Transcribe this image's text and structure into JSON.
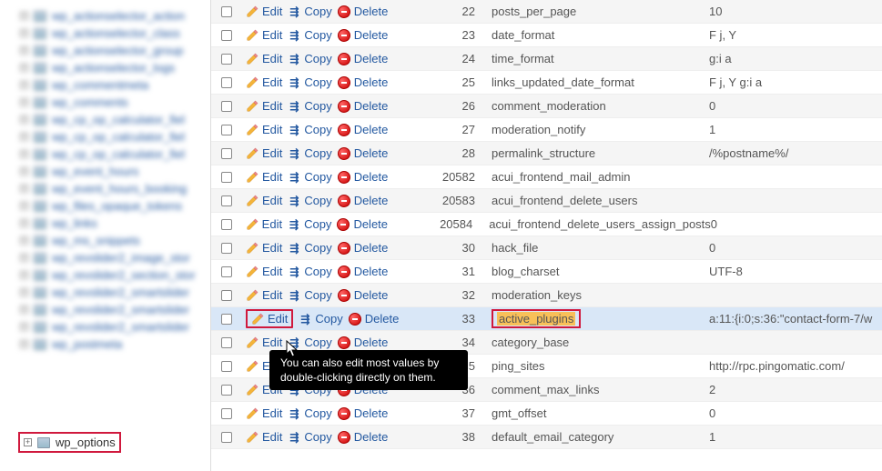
{
  "sidebar": {
    "blurred_items": [
      "wp_actionselector_action",
      "wp_actionselector_class",
      "wp_actionselector_group",
      "wp_actionselector_logs",
      "wp_commentmeta",
      "wp_comments",
      "wp_cp_op_calculator_fiel",
      "wp_cp_op_calculator_fiel",
      "wp_cp_op_calculator_fiel",
      "wp_event_hours",
      "wp_event_hours_booking",
      "wp_files_opaque_tokens",
      "wp_links",
      "wp_ms_snippets",
      "wp_revslider2_image_stor",
      "wp_revslider2_section_stor",
      "wp_revslider2_smartslider",
      "wp_revslider2_smartslider",
      "wp_revslider2_smartslider"
    ],
    "wp_options": "wp_options",
    "postmeta": "wp_postmeta"
  },
  "actions": {
    "edit": "Edit",
    "copy": "Copy",
    "delete": "Delete"
  },
  "tooltip": "You can also edit most values by double-clicking directly on them.",
  "rows": [
    {
      "id": "22",
      "name": "posts_per_page",
      "value": "10",
      "alt": true
    },
    {
      "id": "23",
      "name": "date_format",
      "value": "F j, Y"
    },
    {
      "id": "24",
      "name": "time_format",
      "value": "g:i a",
      "alt": true
    },
    {
      "id": "25",
      "name": "links_updated_date_format",
      "value": "F j, Y g:i a"
    },
    {
      "id": "26",
      "name": "comment_moderation",
      "value": "0",
      "alt": true
    },
    {
      "id": "27",
      "name": "moderation_notify",
      "value": "1"
    },
    {
      "id": "28",
      "name": "permalink_structure",
      "value": "/%postname%/",
      "alt": true
    },
    {
      "id": "20582",
      "name": "acui_frontend_mail_admin",
      "value": ""
    },
    {
      "id": "20583",
      "name": "acui_frontend_delete_users",
      "value": "",
      "alt": true
    },
    {
      "id": "20584",
      "name": "acui_frontend_delete_users_assign_posts",
      "value": "0"
    },
    {
      "id": "30",
      "name": "hack_file",
      "value": "0",
      "alt": true
    },
    {
      "id": "31",
      "name": "blog_charset",
      "value": "UTF-8"
    },
    {
      "id": "32",
      "name": "moderation_keys",
      "value": "",
      "alt": true
    },
    {
      "id": "33",
      "name": "active_plugins",
      "value": "a:11:{i:0;s:36:\"contact-form-7/w",
      "highlight": true,
      "name_highlight": true,
      "edit_highlight": true
    },
    {
      "id": "34",
      "name": "category_base",
      "value": "",
      "alt": true,
      "tooltip_coverage": true
    },
    {
      "id": "35",
      "name": "ping_sites",
      "value": "http://rpc.pingomatic.com/"
    },
    {
      "id": "36",
      "name": "comment_max_links",
      "value": "2",
      "alt": true
    },
    {
      "id": "37",
      "name": "gmt_offset",
      "value": "0"
    },
    {
      "id": "38",
      "name": "default_email_category",
      "value": "1",
      "alt": true
    }
  ]
}
